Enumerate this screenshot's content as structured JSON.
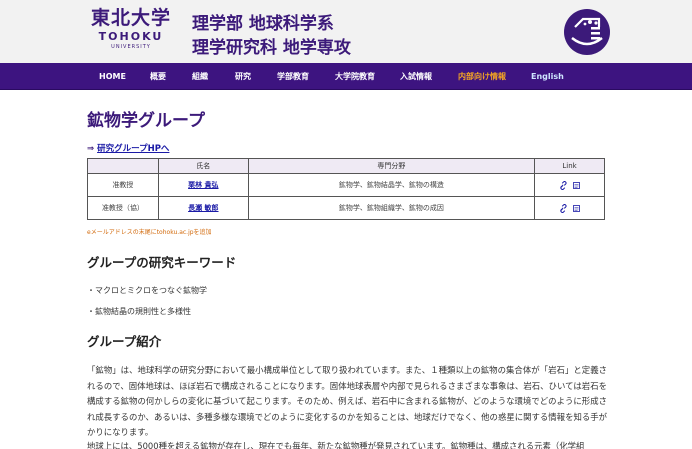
{
  "header": {
    "logo_kanji": "東北大学",
    "logo_en": "TOHOKU",
    "logo_university": "UNIVERSITY",
    "dept_line1": "理学部 地球科学系",
    "dept_line2": "理学研究科 地学専攻",
    "emblem_icon": "faculty-emblem-icon"
  },
  "nav": {
    "items": [
      {
        "label": "HOME"
      },
      {
        "label": "概要"
      },
      {
        "label": "組織"
      },
      {
        "label": "研究"
      },
      {
        "label": "学部教育"
      },
      {
        "label": "大学院教育"
      },
      {
        "label": "入試情報"
      },
      {
        "label": "内部向け情報"
      },
      {
        "label": "English"
      }
    ]
  },
  "page": {
    "title": "鉱物学グループ",
    "hp_arrow": "⇒",
    "hp_link": "研究グループHPへ"
  },
  "members_table": {
    "headers": [
      "",
      "氏名",
      "専門分野",
      "Link"
    ],
    "rows": [
      {
        "position": "准教授",
        "name": "栗林 貴弘",
        "field": "鉱物学、鉱物結晶学、鉱物の構造"
      },
      {
        "position": "准教授（協）",
        "name": "長瀬 敏郎",
        "field": "鉱物学、鉱物組織学、鉱物の成因"
      }
    ]
  },
  "note": "eメールアドレスの末尾にtohoku.ac.jpを追加",
  "keywords": {
    "heading": "グループの研究キーワード",
    "items": [
      "・マクロとミクロをつなぐ鉱物学",
      "・鉱物結晶の規則性と多様性"
    ]
  },
  "intro": {
    "heading": "グループ紹介",
    "paragraph1": "「鉱物」は、地球科学の研究分野において最小構成単位として取り扱われています。また、１種類以上の鉱物の集合体が「岩石」と定義されるので、固体地球は、ほぼ岩石で構成されることになります。固体地球表層や内部で見られるさまざまな事象は、岩石、ひいては岩石を構成する鉱物の何かしらの変化に基づいて起こります。そのため、例えば、岩石中に含まれる鉱物が、どのような環境でどのように形成され成長するのか、あるいは、多種多様な環境でどのように変化するのかを知ることは、地球だけでなく、他の惑星に関する情報を知る手がかりになります。",
    "paragraph2": "地球上には、5000種を超える鉱物が存在し、現在でも毎年、新たな鉱物種が発見されています。鉱物種は、構成される元素（化学組"
  },
  "colors": {
    "brand_purple": "#3c1a7a",
    "nav_bg": "#3d1480",
    "nav_current": "#f5a623",
    "link_blue": "#1a1aa6",
    "note_orange": "#d26a0c"
  }
}
